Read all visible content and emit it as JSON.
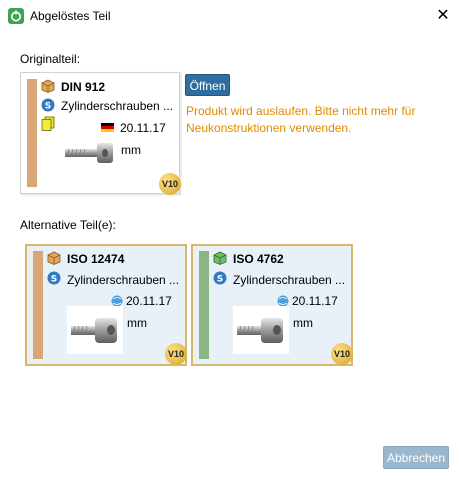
{
  "window": {
    "title": "Abgelöstes Teil"
  },
  "original_section": {
    "label": "Originalteil:"
  },
  "original_part": {
    "name": "DIN 912",
    "description": "Zylinderschrauben ...",
    "date": "20.11.17",
    "unit": "mm",
    "version_badge": "V10",
    "stripe_color": "#d9a678"
  },
  "open_button": {
    "label": "Öffnen"
  },
  "warning_text": "Produkt wird auslaufen. Bitte nicht mehr für Neukonstruktionen verwenden.",
  "alternatives_section": {
    "label": "Alternative Teil(e):"
  },
  "alternatives": [
    {
      "name": "ISO 12474",
      "description": "Zylinderschrauben ...",
      "date": "20.11.17",
      "unit": "mm",
      "version_badge": "V10",
      "stripe_color": "#d9a678"
    },
    {
      "name": "ISO 4762",
      "description": "Zylinderschrauben ...",
      "date": "20.11.17",
      "unit": "mm",
      "version_badge": "V10",
      "stripe_color": "#8ab585"
    }
  ],
  "cancel_button": {
    "label": "Abbrechen"
  },
  "colors": {
    "accent": "#2f6e9e",
    "warning": "#e08a00",
    "card_highlight_border": "#d7b76c",
    "card_highlight_bg": "#e8f0f8"
  }
}
